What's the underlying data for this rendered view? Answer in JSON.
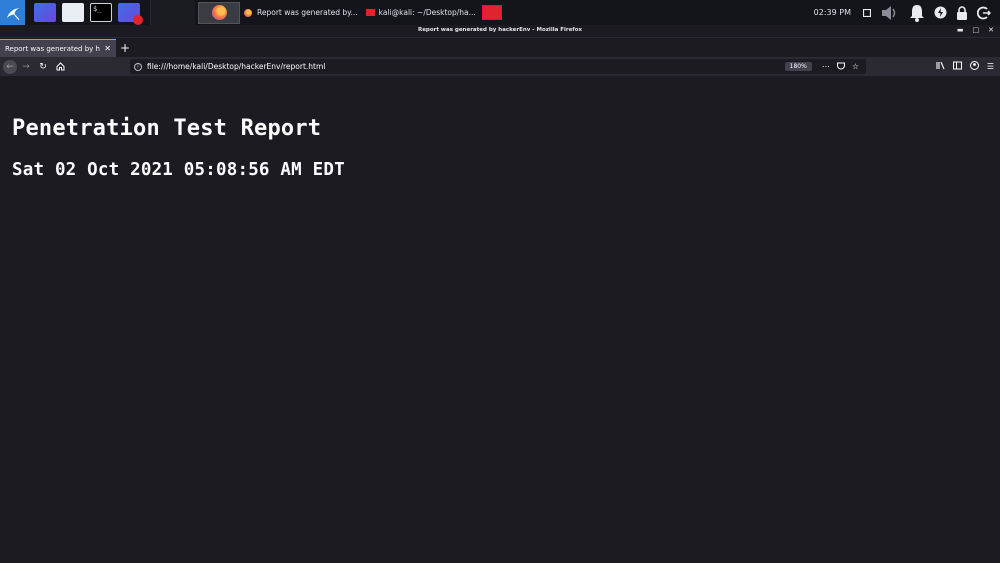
{
  "panel": {
    "launchers": [
      "show-desktop",
      "file-manager",
      "terminal",
      "screen-recorder"
    ],
    "tasks": [
      {
        "label": "Report was generated by...",
        "icon": "firefox-icon"
      },
      {
        "label": "kali@kali: ~/Desktop/ha...",
        "icon": "terminal-icon"
      }
    ],
    "terminal_prompt": "$_",
    "clock": "02:39 PM"
  },
  "window": {
    "title": "Report was generated by hackerEnv - Mozilla Firefox"
  },
  "browser": {
    "tab_label": "Report was generated by hackerEnv",
    "url": "file:///home/kali/Desktop/hackerEnv/report.html",
    "zoom": "180%"
  },
  "page": {
    "heading": "Penetration Test Report",
    "date": "Sat 02 Oct 2021 05:08:56 AM EDT"
  },
  "colors": {
    "page_bg": "#1c1b22",
    "panel_bg": "#14151a",
    "accent_blue": "#2f7fd8",
    "record_red": "#e0232c"
  }
}
